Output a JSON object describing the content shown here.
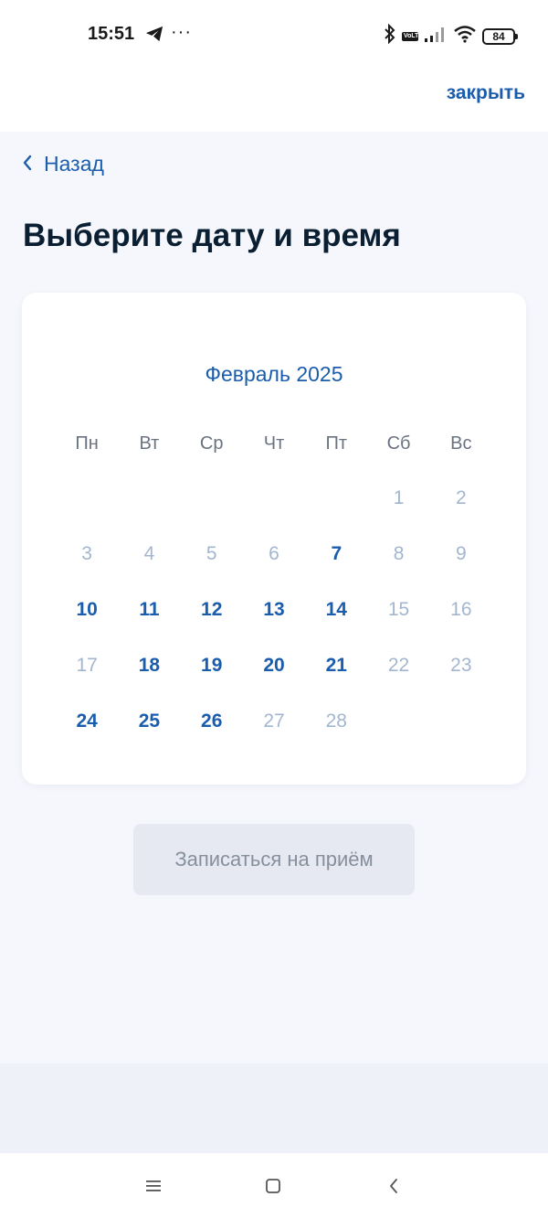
{
  "status_bar": {
    "time": "15:51",
    "dots": "···",
    "volte": "VoLTE",
    "battery": "84"
  },
  "header": {
    "close_label": "закрыть"
  },
  "nav": {
    "back_label": "Назад"
  },
  "page": {
    "title": "Выберите дату и время"
  },
  "calendar": {
    "month_label": "Февраль 2025",
    "weekdays": [
      "Пн",
      "Вт",
      "Ср",
      "Чт",
      "Пт",
      "Сб",
      "Вс"
    ],
    "weeks": [
      [
        {
          "label": "",
          "state": "empty"
        },
        {
          "label": "",
          "state": "empty"
        },
        {
          "label": "",
          "state": "empty"
        },
        {
          "label": "",
          "state": "empty"
        },
        {
          "label": "",
          "state": "empty"
        },
        {
          "label": "1",
          "state": "inactive"
        },
        {
          "label": "2",
          "state": "inactive"
        }
      ],
      [
        {
          "label": "3",
          "state": "inactive"
        },
        {
          "label": "4",
          "state": "inactive"
        },
        {
          "label": "5",
          "state": "inactive"
        },
        {
          "label": "6",
          "state": "inactive"
        },
        {
          "label": "7",
          "state": "active"
        },
        {
          "label": "8",
          "state": "inactive"
        },
        {
          "label": "9",
          "state": "inactive"
        }
      ],
      [
        {
          "label": "10",
          "state": "active"
        },
        {
          "label": "11",
          "state": "active"
        },
        {
          "label": "12",
          "state": "active"
        },
        {
          "label": "13",
          "state": "active"
        },
        {
          "label": "14",
          "state": "active"
        },
        {
          "label": "15",
          "state": "inactive"
        },
        {
          "label": "16",
          "state": "inactive"
        }
      ],
      [
        {
          "label": "17",
          "state": "inactive"
        },
        {
          "label": "18",
          "state": "active"
        },
        {
          "label": "19",
          "state": "active"
        },
        {
          "label": "20",
          "state": "active"
        },
        {
          "label": "21",
          "state": "active"
        },
        {
          "label": "22",
          "state": "inactive"
        },
        {
          "label": "23",
          "state": "inactive"
        }
      ],
      [
        {
          "label": "24",
          "state": "active"
        },
        {
          "label": "25",
          "state": "active"
        },
        {
          "label": "26",
          "state": "active"
        },
        {
          "label": "27",
          "state": "inactive"
        },
        {
          "label": "28",
          "state": "inactive"
        },
        {
          "label": "",
          "state": "empty"
        },
        {
          "label": "",
          "state": "empty"
        }
      ]
    ]
  },
  "actions": {
    "submit_label": "Записаться на приём",
    "submit_enabled": false
  },
  "colors": {
    "accent": "#1b5dad",
    "title": "#0b1f33",
    "inactive_day": "#a3b6d0",
    "disabled_button_bg": "#e6e9f2",
    "disabled_button_text": "#86909c",
    "page_bg": "#f5f7fc"
  },
  "icons": {
    "back": "chevron-left-icon",
    "telegram": "telegram-icon",
    "bluetooth": "bluetooth-icon",
    "signal": "signal-icon",
    "wifi": "wifi-icon",
    "battery": "battery-icon",
    "nav_menu": "menu-icon",
    "nav_home": "home-icon",
    "nav_back": "back-icon"
  }
}
